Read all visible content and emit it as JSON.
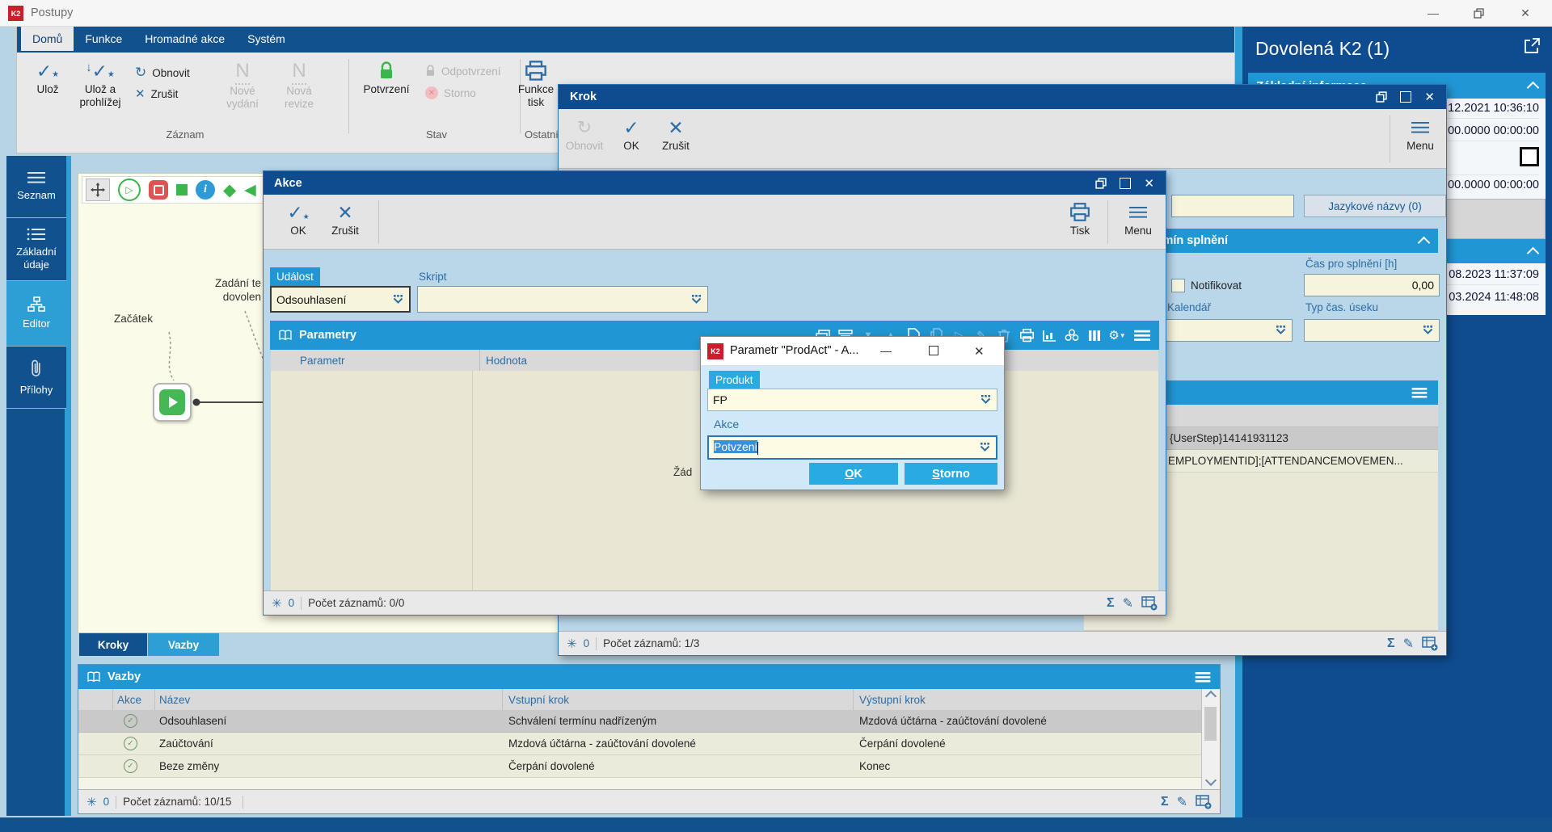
{
  "window": {
    "title": "Postupy",
    "logo": "K2"
  },
  "icons": {
    "check": "✓",
    "cross": "✕",
    "refresh": "↻",
    "sigma": "Σ",
    "pencil": "✎",
    "asterisk": "✳",
    "letter_n": "N",
    "info": "i",
    "play": "▷",
    "square": "■",
    "diamond": "◆",
    "triangle_left": "◀",
    "minimize": "—",
    "tri_down": "▼",
    "tri_up": "▲",
    "gear": "⚙",
    "star": "★"
  },
  "ribbon": {
    "tabs": [
      {
        "label": "Domů"
      },
      {
        "label": "Funkce"
      },
      {
        "label": "Hromadné akce"
      },
      {
        "label": "Systém"
      }
    ],
    "buttons": {
      "uloz": "Ulož",
      "uloz_a_prohlizej": "Ulož a prohlížej",
      "obnovit": "Obnovit",
      "zrusit": "Zrušit",
      "nove_vydani": "Nové vydání",
      "nova_revize": "Nová revize",
      "potvrzeni": "Potvrzení",
      "odpotvrzeni": "Odpotvrzení",
      "storno": "Storno",
      "funkce_tisk": "Funkce tisk"
    },
    "groups": [
      "Záznam",
      "Stav",
      "Ostatní"
    ]
  },
  "sidebar": {
    "items": [
      {
        "label": "Seznam"
      },
      {
        "label": "Základní údaje"
      },
      {
        "label": "Editor"
      },
      {
        "label": "Přílohy"
      }
    ]
  },
  "canvas": {
    "start_label": "Začátek",
    "step_label_line1": "Zadání te",
    "step_label_line2": "dovolen"
  },
  "bottom_tabs": {
    "kroky": "Kroky",
    "vazby": "Vazby"
  },
  "vazby_panel": {
    "title": "Vazby",
    "columns": {
      "akce": "Akce",
      "nazev": "Název",
      "vstupni": "Vstupní krok",
      "vystupni": "Výstupní krok"
    },
    "rows": [
      {
        "nazev": "Odsouhlasení",
        "vstupni": "Schválení termínu nadřízeným",
        "vystupni": "Mzdová účtárna - zaúčtování dovolené"
      },
      {
        "nazev": "Zaúčtování",
        "vstupni": "Mzdová účtárna - zaúčtování dovolené",
        "vystupni": "Čerpání dovolené"
      },
      {
        "nazev": "Beze změny",
        "vstupni": "Čerpání dovolené",
        "vystupni": "Konec"
      }
    ],
    "status": {
      "count": "0",
      "records": "Počet záznamů: 10/15"
    }
  },
  "krok_window": {
    "title": "Krok",
    "toolbar": {
      "obnovit": "Obnovit",
      "ok": "OK",
      "zrusit": "Zrušit",
      "menu": "Menu"
    },
    "fields": {
      "jazykove_nazvy": "Jazykové názvy (0)",
      "termin_header": "Termín splnění",
      "cas_label": "Čas pro splnění [h]",
      "cas_value": "0,00",
      "notifikovat": "Notifikovat",
      "kalendar": "Kalendář",
      "typ_label": "Typ čas. úseku"
    },
    "list_rows": [
      "{UserStep}14141931123",
      "EMPLOYMENTID];[ATTENDANCEMOVEMEN..."
    ],
    "status": {
      "count": "0",
      "records": "Počet záznamů: 1/3"
    }
  },
  "akce_window": {
    "title": "Akce",
    "toolbar": {
      "ok": "OK",
      "zrusit": "Zrušit",
      "tisk": "Tisk",
      "menu": "Menu"
    },
    "fields": {
      "udalost_label": "Událost",
      "udalost_value": "Odsouhlasení",
      "skript_label": "Skript"
    },
    "parametry": {
      "title": "Parametry",
      "col_parametr": "Parametr",
      "col_hodnota": "Hodnota",
      "empty_fragment": "Žád"
    },
    "status": {
      "count": "0",
      "records": "Počet záznamů: 0/0"
    }
  },
  "param_dialog": {
    "title": "Parametr \"ProdAct\" - A...",
    "produkt_label": "Produkt",
    "produkt_value": "FP",
    "akce_label": "Akce",
    "akce_value": "Potvzeni",
    "ok_initial": "O",
    "ok_rest": "K",
    "storno_initial": "S",
    "storno_rest": "torno"
  },
  "right_panel": {
    "title": "Dovolená K2 (1)",
    "section1_title": "Základní informace",
    "value1": "12.2021 10:36:10",
    "value2": "00.0000 00:00:00",
    "value3": "00.0000 00:00:00",
    "date1": "08.2023 11:37:09",
    "date2": "03.2024 11:48:08"
  },
  "colors": {
    "title_blue": "#0f4c8f",
    "cyan": "#2097d4",
    "green": "#3cb54a",
    "beige": "#ebebdb",
    "canvas": "#fbfbe9",
    "selection": "#3b8fd6"
  }
}
